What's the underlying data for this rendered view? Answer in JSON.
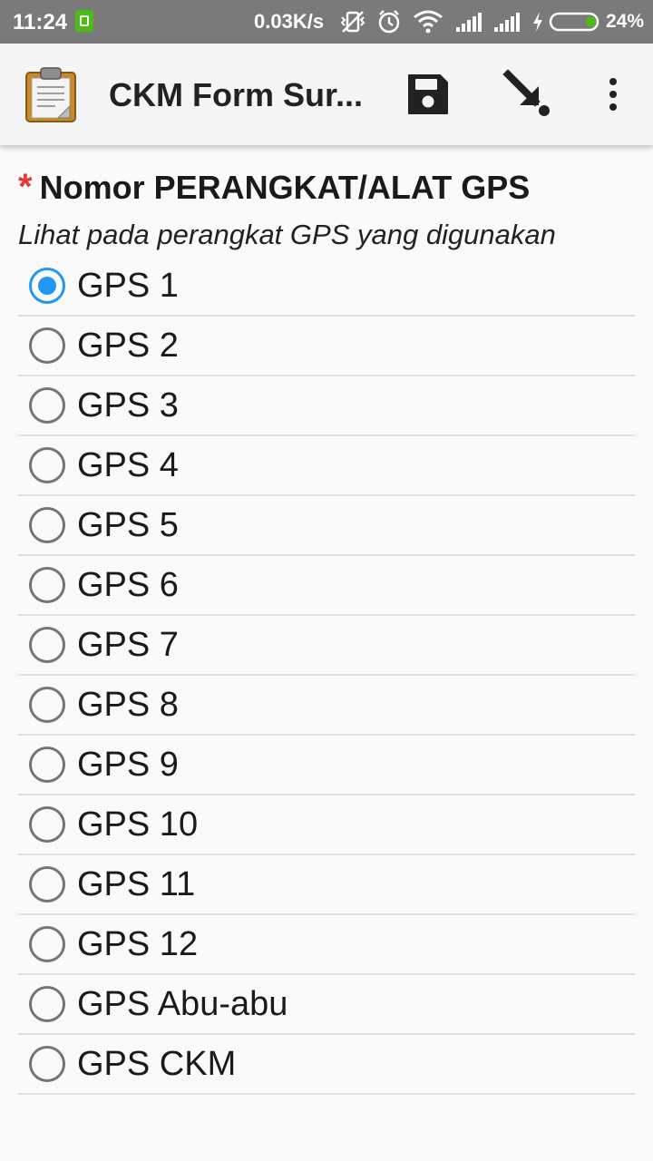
{
  "status_bar": {
    "time": "11:24",
    "network_speed": "0.03K/s",
    "battery_percent": "24%",
    "icons": [
      "notification-icon",
      "vibrate-off-icon",
      "alarm-icon",
      "wifi-icon",
      "signal-icon",
      "signal-icon",
      "charging-icon",
      "battery-icon"
    ]
  },
  "app_bar": {
    "title": "CKM Form Sur...",
    "icons": [
      "clipboard-app-icon",
      "save-icon",
      "jump-icon",
      "overflow-menu-icon"
    ]
  },
  "form": {
    "required_marker": "*",
    "question": "Nomor PERANGKAT/ALAT GPS",
    "hint": "Lihat pada perangkat GPS yang digunakan",
    "selected_index": 0,
    "options": [
      "GPS 1",
      "GPS 2",
      "GPS 3",
      "GPS 4",
      "GPS 5",
      "GPS 6",
      "GPS 7",
      "GPS 8",
      "GPS 9",
      "GPS 10",
      "GPS 11",
      "GPS 12",
      "GPS Abu-abu",
      "GPS CKM"
    ]
  },
  "colors": {
    "accent": "#2196f3",
    "required": "#e53935",
    "status_bar": "#7a7a7a",
    "notification": "#4cbb17"
  }
}
